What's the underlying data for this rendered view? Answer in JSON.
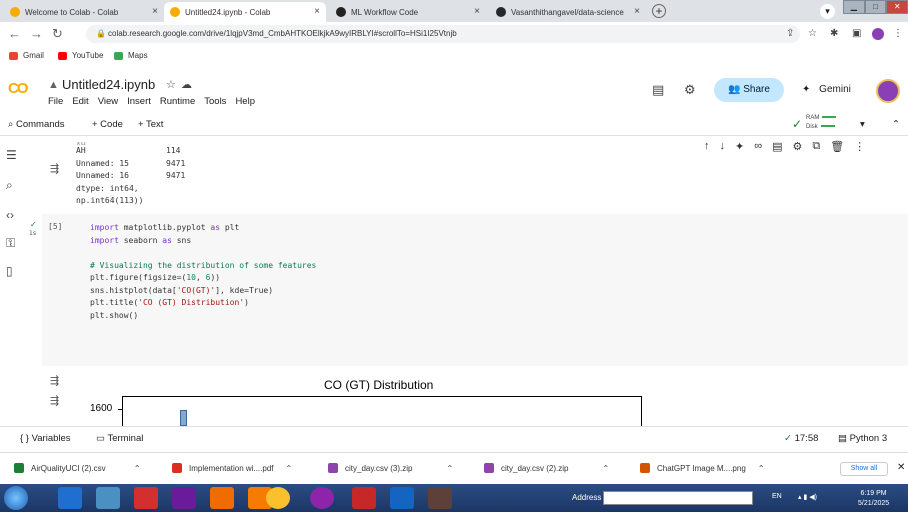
{
  "browser": {
    "tabs": [
      {
        "title": "Welcome to Colab - Colab",
        "icon": "colab-icon"
      },
      {
        "title": "Untitled24.ipynb - Colab",
        "icon": "colab-icon",
        "active": true
      },
      {
        "title": "ML Workflow Code",
        "icon": "chatgpt-icon"
      },
      {
        "title": "Vasanthithangavel/data-science",
        "icon": "github-icon"
      }
    ],
    "new_tab": "+",
    "close_glyph": "×",
    "url": "colab.research.google.com/drive/1lqjpV3md_CmbAHTKOElkjkA9wyIRBLYI#scrollTo=HSi1I25Vtnjb",
    "bookmarks": [
      {
        "label": "Gmail",
        "color": "#ea4335"
      },
      {
        "label": "YouTube",
        "color": "#ff0000"
      },
      {
        "label": "Maps",
        "color": "#34a853"
      }
    ]
  },
  "colab": {
    "logo": "CO",
    "notebook_title": "Untitled24.ipynb",
    "menu": [
      "File",
      "Edit",
      "View",
      "Insert",
      "Runtime",
      "Tools",
      "Help"
    ],
    "share_label": "Share",
    "gemini_label": "Gemini",
    "toolbar": {
      "commands": "Commands",
      "add_code": "+ Code",
      "add_text": "+ Text",
      "ram": "RAM",
      "disk": "Disk"
    }
  },
  "cells": {
    "prev_output": [
      {
        "name": "AH",
        "value": "114"
      },
      {
        "name": "AH",
        "value": "114"
      },
      {
        "name": "Unnamed: 15",
        "value": "9471"
      },
      {
        "name": "Unnamed: 16",
        "value": "9471"
      }
    ],
    "prev_dtype": "dtype: int64,",
    "prev_npint": "np.int64(113))",
    "exec_count": "[5]",
    "exec_time": "1s",
    "code_lines": {
      "l1_kw": "import",
      "l1_rest": " matplotlib.pyplot ",
      "l1_as": "as",
      "l1_alias": " plt",
      "l2_kw": "import",
      "l2_rest": " seaborn ",
      "l2_as": "as",
      "l2_alias": " sns",
      "l3_comment": "# Visualizing the distribution of some features",
      "l4_pre": "plt.figure(figsize=(",
      "l4_n1": "10",
      "l4_mid": ", ",
      "l4_n2": "6",
      "l4_post": "))",
      "l5_pre": "sns.histplot(data[",
      "l5_str": "'CO(GT)'",
      "l5_post": "], kde=True)",
      "l6_pre": "plt.title(",
      "l6_str": "'CO (GT) Distribution'",
      "l6_post": ")",
      "l7": "plt.show()"
    }
  },
  "chart_data": {
    "type": "bar",
    "title": "CO (GT) Distribution",
    "yticks": [
      1600
    ]
  },
  "bottom_panel": {
    "variables": "Variables",
    "terminal": "Terminal",
    "time": "17:58",
    "runtime": "Python 3"
  },
  "downloads": {
    "items": [
      {
        "name": "AirQualityUCI (2).csv",
        "color": "#1e7e34"
      },
      {
        "name": "Implementation wi....pdf",
        "color": "#d93025"
      },
      {
        "name": "city_day.csv (3).zip",
        "color": "#8e44ad"
      },
      {
        "name": "city_day.csv (2).zip",
        "color": "#8e44ad"
      },
      {
        "name": "ChatGPT Image M....png",
        "color": "#d35400"
      }
    ],
    "show_all": "Show all"
  },
  "taskbar": {
    "address_label": "Address",
    "lang": "EN",
    "time": "6:19 PM",
    "date": "5/21/2025"
  }
}
